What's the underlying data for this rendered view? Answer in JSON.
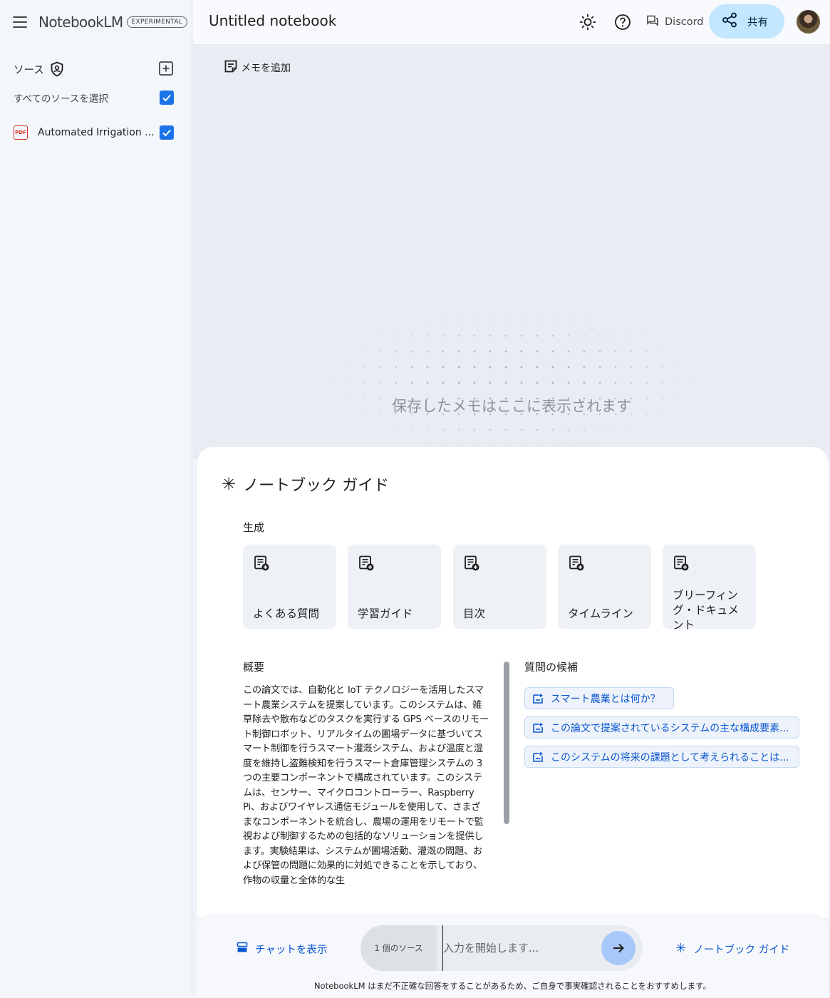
{
  "app": {
    "name": "NotebookLM",
    "badge": "EXPERIMENTAL"
  },
  "sidebar": {
    "sources_title": "ソース",
    "select_all_label": "すべてのソースを選択",
    "select_all_checked": true,
    "sources": [
      {
        "type": "PDF",
        "name": "Automated Irrigation ...",
        "checked": true
      }
    ]
  },
  "header": {
    "notebook_title": "Untitled notebook",
    "discord_label": "Discord",
    "share_label": "共有"
  },
  "notes": {
    "add_note_label": "メモを追加",
    "empty_message": "保存したメモはここに表示されます"
  },
  "guide": {
    "title": "ノートブック ガイド",
    "generate_label": "生成",
    "generate_items": [
      {
        "label": "よくある質問"
      },
      {
        "label": "学習ガイド"
      },
      {
        "label": "目次"
      },
      {
        "label": "タイムライン"
      },
      {
        "label": "ブリーフィング・ドキュメント"
      }
    ],
    "summary_label": "概要",
    "summary_text": "この論文では、自動化と IoT テクノロジーを活用したスマート農業システムを提案しています。このシステムは、雑草除去や散布などのタスクを実行する GPS ベースのリモート制御ロボット、リアルタイムの圃場データに基づいてスマート制御を行うスマート灌漑システム、および温度と湿度を維持し盗難検知を行うスマート倉庫管理システムの 3 つの主要コンポーネントで構成されています。このシステムは、センサー、マイクロコントローラー、Raspberry Pi、およびワイヤレス通信モジュールを使用して、さまざまなコンポーネントを統合し、農場の運用をリモートで監視および制御するための包括的なソリューションを提供します。実験結果は、システムが圃場活動、灌漑の問題、および保管の問題に効果的に対処できることを示しており、作物の収量と全体的な生",
    "questions_label": "質問の候補",
    "questions": [
      "スマート農業とは何か？",
      "この論文で提案されているシステムの主な構成要素...",
      "このシステムの将来の課題として考えられることは..."
    ]
  },
  "chat": {
    "show_chat_label": "チャットを表示",
    "source_count": "1 個のソース",
    "input_placeholder": "入力を開始します...",
    "guide_button_label": "ノートブック ガイド",
    "disclaimer": "NotebookLM はまだ不正確な回答をすることがあるため、ご自身で事実確認されることをおすすめします。"
  },
  "colors": {
    "accent": "#0b57d0",
    "share_bg": "#c2e7ff",
    "checkbox": "#1a73e8",
    "send_bg": "#a8c7fa",
    "pdf_red": "#d93025"
  },
  "icons": {
    "menu": "menu-icon",
    "shield": "shield-icon",
    "add_source": "add-box-icon",
    "theme": "brightness-icon",
    "help": "help-icon",
    "discord": "forum-icon",
    "share": "share-icon",
    "add_note": "sticky-note-icon",
    "sparkle": "sparkle-icon",
    "generate": "note-add-icon",
    "question": "quick-question-icon",
    "chat": "chat-panel-icon",
    "send": "arrow-right-icon"
  }
}
